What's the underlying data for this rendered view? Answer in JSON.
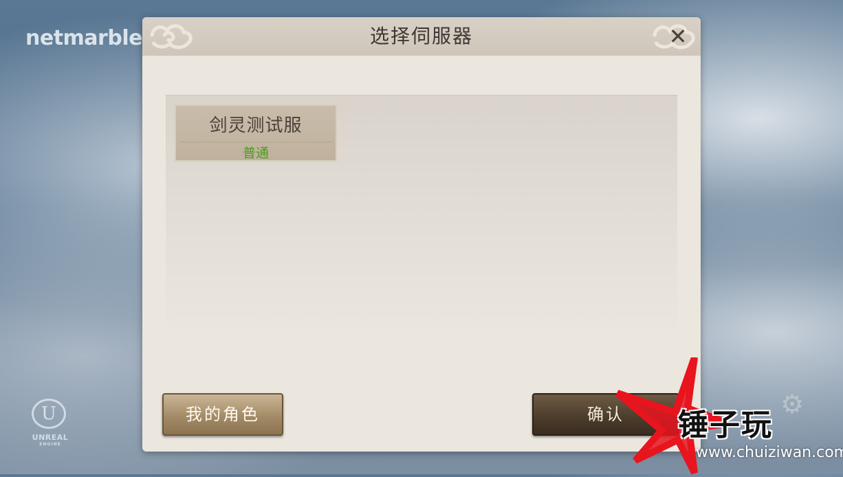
{
  "brand": {
    "logo_text": "netmarble"
  },
  "engine": {
    "name": "UNREAL",
    "sub": "ENGINE"
  },
  "dialog": {
    "title": "选择伺服器",
    "close_glyph": "✕",
    "servers": [
      {
        "name": "剑灵测试服",
        "status": "普通",
        "status_color": "#4e9a1e"
      }
    ],
    "buttons": {
      "my_characters": "我的角色",
      "confirm": "确认"
    }
  },
  "watermark": {
    "text": "锤子玩",
    "url": "www.chuiziwan.com",
    "color": "#e8141e"
  },
  "icons": {
    "close": "close-icon",
    "gear": "gear-icon",
    "ornament": "cloud-ornament-icon"
  }
}
